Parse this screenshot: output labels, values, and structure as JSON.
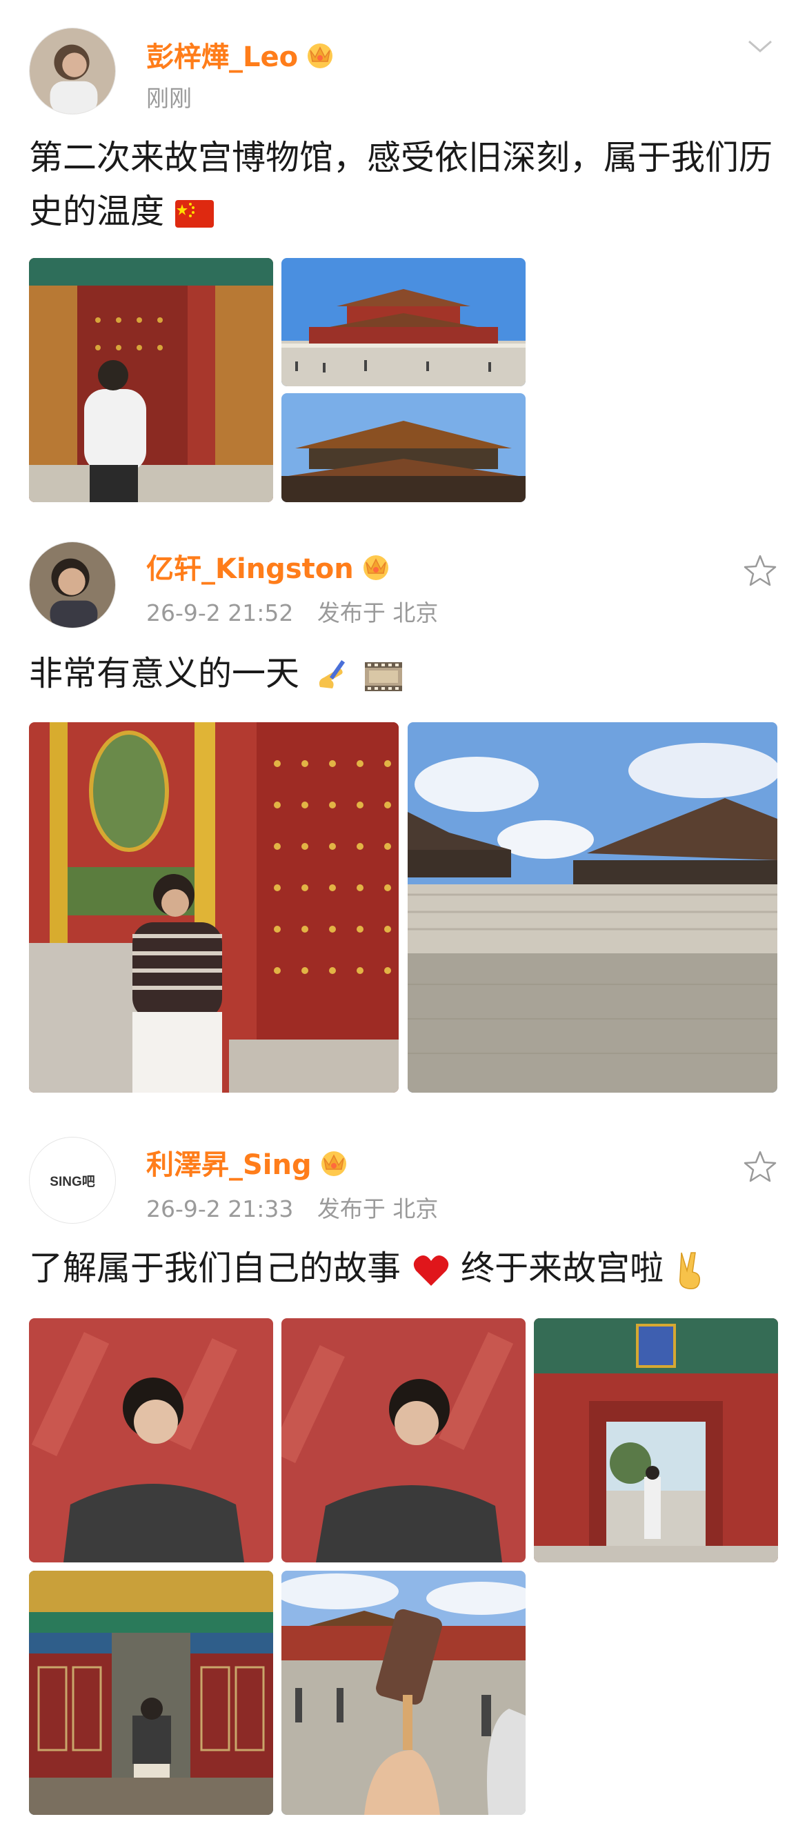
{
  "posts": [
    {
      "username": "彭梓燁_Leo",
      "time": "刚刚",
      "content": "第二次来故宫博物馆，感受依旧深刻，属于我们历史的温度",
      "emoji": "china-flag-emoji",
      "control": "chevron-down-icon",
      "photos": 3
    },
    {
      "username": "亿轩_Kingston",
      "time": "26-9-2 21:52",
      "location": "发布于 北京",
      "content": "非常有意义的一天",
      "emoji": "writing-hand-film-emoji",
      "control": "star-icon",
      "photos": 2
    },
    {
      "username": "利澤昇_Sing",
      "avatar_text": "SING吧",
      "time": "26-9-2 21:33",
      "location": "发布于 北京",
      "content_a": "了解属于我们自己的故事",
      "content_b": "终于来故宫啦",
      "control": "star-icon",
      "photos": 5
    }
  ],
  "colors": {
    "username": "#ff7d1a",
    "meta": "#9a9a9a",
    "palace_red": "#b3322d",
    "sky_blue": "#3f86d8"
  }
}
